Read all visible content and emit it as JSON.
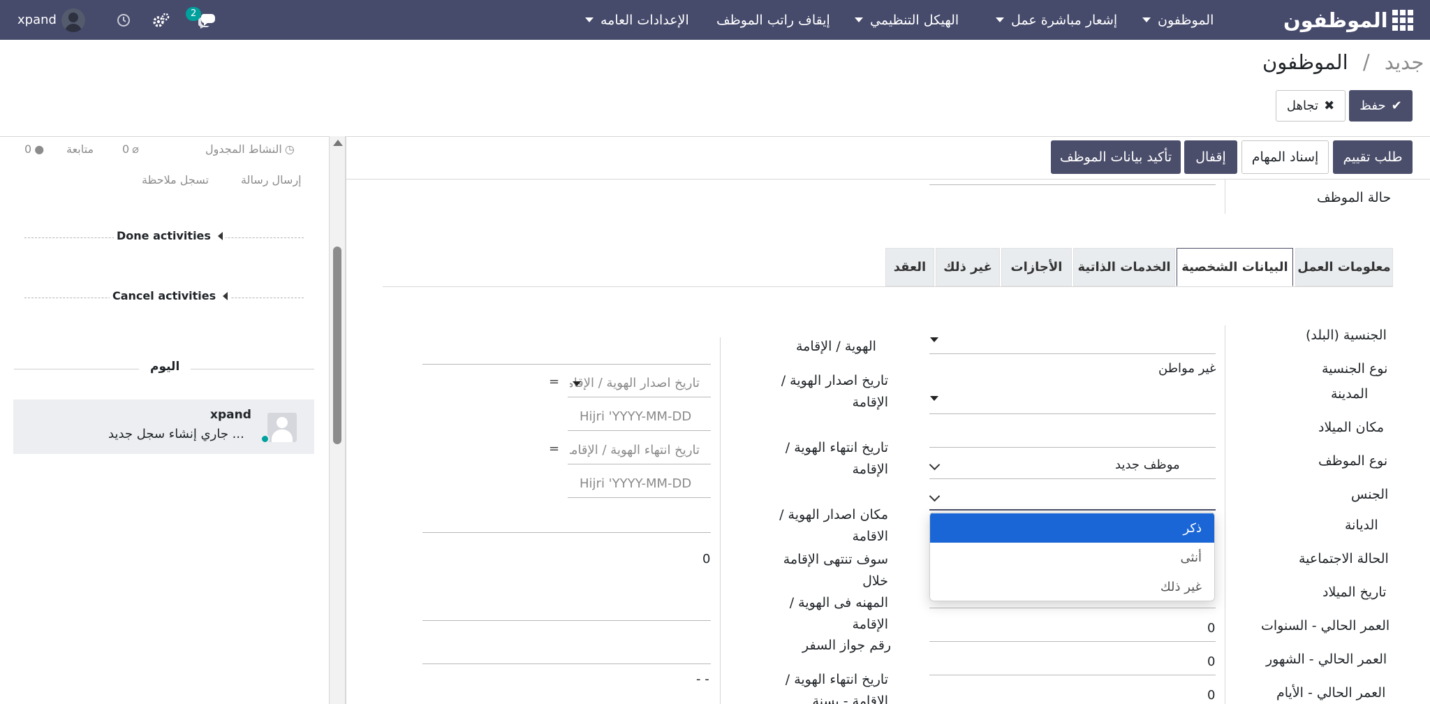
{
  "navbar": {
    "app_title": "الموظفون",
    "menu": [
      {
        "label": "الموظفون"
      },
      {
        "label": "إشعار مباشرة عمل"
      },
      {
        "label": "الهيكل التنظيمي"
      },
      {
        "label": "إيقاف راتب الموظف"
      },
      {
        "label": "الإعدادات العامه"
      }
    ],
    "user_name": "xpand",
    "messages_count": "2"
  },
  "breadcrumb": {
    "parent": "الموظفون",
    "separator": "/",
    "current": "جديد"
  },
  "actions": {
    "save": "حفظ",
    "discard": "تجاهل"
  },
  "status_buttons": {
    "request_evaluation": "طلب تقييم",
    "assign_tasks": "إسناد المهام",
    "lock": "إقفال",
    "confirm_employee": "تأكيد بيانات الموظف"
  },
  "form": {
    "employee_status_label": "حالة الموظف",
    "tabs": [
      {
        "label": "معلومات العمل"
      },
      {
        "label": "البيانات الشخصية"
      },
      {
        "label": "الخدمات الذاتية"
      },
      {
        "label": "الأجازات"
      },
      {
        "label": "غير ذلك"
      },
      {
        "label": "العقد"
      }
    ],
    "left_labels": {
      "nationality": "الجنسية (البلد)",
      "nationality_type": "نوع الجنسية",
      "city": "المدينة",
      "birth_place": "مكان الميلاد",
      "employee_type": "نوع الموظف",
      "gender": "الجنس",
      "religion": "الديانة",
      "marital_status": "الحالة الاجتماعية",
      "birth_date": "تاريخ الميلاد",
      "age_years": "العمر الحالي - السنوات",
      "age_months": "العمر الحالي - الشهور",
      "age_days": "العمر الحالي - الأيام"
    },
    "left_values": {
      "nationality_type": "غير مواطن",
      "employee_type": "موظف جديد",
      "age_years": "0",
      "age_months": "0",
      "age_days": "0"
    },
    "right_labels": {
      "id_residence": "الهوية / الإقامة",
      "id_issue_date": "تاريخ اصدار الهوية / الإقامة",
      "id_expiry_date": "تاريخ انتهاء الهوية / الإقامة",
      "id_issue_place": "مكان اصدار الهوية / الاقامة",
      "residence_expires_in": "سوف تنتهى الإقامة خلال",
      "id_profession": "المهنه فى الهوية / الإقامة",
      "passport_no": "رقم جواز السفر",
      "id_expiry_date_year": "تاريخ انتهاء الهوية / الإقامة - بسنة"
    },
    "right_values": {
      "residence_expires_in": "0",
      "id_expiry_date_year": "- -"
    },
    "placeholders": {
      "id_issue_date": "تاريخ اصدار الهوية / الإقامة",
      "id_issue_hijri": "Hijri 'YYYY-MM-DD",
      "id_expiry_date": "تاريخ انتهاء الهوية / الإقامة",
      "id_expiry_hijri": "Hijri 'YYYY-MM-DD"
    },
    "gender_options": [
      {
        "label": "ذكر",
        "selected": true
      },
      {
        "label": "أنثى",
        "selected": false
      },
      {
        "label": "غير ذلك",
        "selected": false
      }
    ]
  },
  "chatter": {
    "scheduled_activity": "النشاط المجدول",
    "attachments_count": "0",
    "follow": "متابعة",
    "followers_count": "0",
    "send_message": "إرسال رسالة",
    "log_note": "تسجل ملاحظة",
    "done_activities": "Done activities",
    "cancel_activities": "Cancel activities",
    "today": "اليوم",
    "message": {
      "author": "xpand",
      "body": "جاري إنشاء سجل جديد ..."
    }
  },
  "colors": {
    "navbar_bg": "#464a6b",
    "primary": "#4b4e6b",
    "selected_option": "#1a66d6",
    "badge": "#00a09d"
  }
}
